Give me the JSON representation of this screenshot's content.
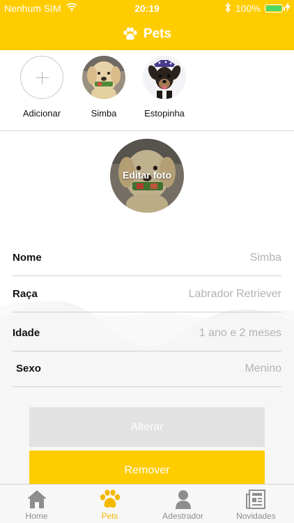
{
  "status_bar": {
    "carrier": "Nenhum SIM",
    "time": "20:19",
    "battery": "100%"
  },
  "nav": {
    "title": "Pets",
    "icon": "paw-icon"
  },
  "pets_strip": {
    "add_label": "Adicionar",
    "pets": [
      {
        "name": "Simba",
        "photo": "golden-retriever-photo"
      },
      {
        "name": "Estopinha",
        "photo": "small-dog-photo"
      }
    ]
  },
  "profile_photo": {
    "label": "Editar foto"
  },
  "form": {
    "fields": [
      {
        "label": "Nome",
        "value": "Simba"
      },
      {
        "label": "Raça",
        "value": "Labrador Retriever"
      },
      {
        "label": "Idade",
        "value": "1 ano e 2 meses"
      },
      {
        "label": "Sexo",
        "value": "Menino"
      }
    ]
  },
  "actions": {
    "update_label": "Alterar",
    "remove_label": "Remover"
  },
  "tabbar": {
    "active": "Pets",
    "tabs": [
      {
        "label": "Home",
        "icon": "home-icon"
      },
      {
        "label": "Pets",
        "icon": "paw-icon"
      },
      {
        "label": "Adestrador",
        "icon": "person-icon"
      },
      {
        "label": "Novidades",
        "icon": "newspaper-icon"
      }
    ]
  },
  "colors": {
    "brand_yellow": "#FFCC00",
    "disabled_button": "#E2E2E2",
    "tab_inactive": "#8E8E8E"
  }
}
